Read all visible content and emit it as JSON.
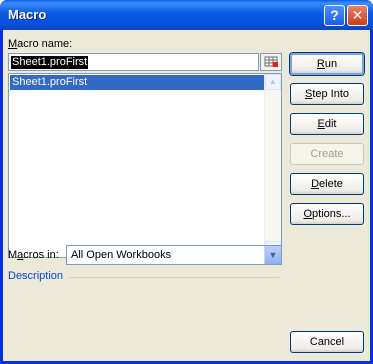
{
  "window": {
    "title": "Macro"
  },
  "title_buttons": {
    "help": "?",
    "close": "✕"
  },
  "macro_name": {
    "label_prefix": "",
    "label_mnemonic": "M",
    "label_rest": "acro name:",
    "value": "Sheet1.proFirst"
  },
  "macro_list": {
    "items": [
      "Sheet1.proFirst"
    ],
    "selected_index": 0
  },
  "buttons": {
    "run": {
      "mnemonic": "R",
      "rest": "un"
    },
    "step_into": {
      "mnemonic": "S",
      "rest": "tep Into"
    },
    "edit": {
      "mnemonic": "E",
      "rest": "dit"
    },
    "create": {
      "label": "Create"
    },
    "delete": {
      "mnemonic": "D",
      "rest": "elete"
    },
    "options": {
      "mnemonic": "O",
      "rest": "ptions..."
    },
    "cancel": {
      "label": "Cancel"
    }
  },
  "macros_in": {
    "label_prefix": "M",
    "label_mnemonic": "a",
    "label_rest": "cros in:",
    "value": "All Open Workbooks"
  },
  "description": {
    "label": "Description"
  },
  "icons": {
    "refedit": "refedit-icon",
    "scroll_up": "scroll-up-arrow-icon",
    "scroll_down": "scroll-down-arrow-icon",
    "dropdown": "chevron-down-icon"
  },
  "colors": {
    "title_bar": "#0a5ae6",
    "selection": "#316ac5",
    "dialog_bg": "#ece9d8",
    "description_text": "#0046d5"
  }
}
